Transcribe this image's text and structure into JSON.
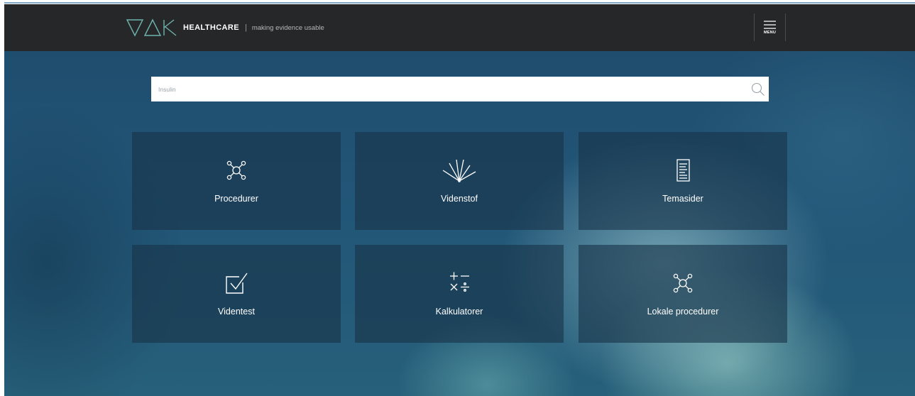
{
  "header": {
    "brand": "HEALTHCARE",
    "separator": "|",
    "tagline": "making evidence usable",
    "menu_label": "MENU",
    "logo_icon": "vak-logo-icon",
    "menu_icon": "hamburger-menu-icon"
  },
  "search": {
    "placeholder": "Insulin",
    "icon": "search-icon"
  },
  "tiles": [
    {
      "label": "Procedurer",
      "icon": "network-nodes-icon"
    },
    {
      "label": "Videnstof",
      "icon": "light-rays-icon"
    },
    {
      "label": "Temasider",
      "icon": "document-icon"
    },
    {
      "label": "Videntest",
      "icon": "checkbox-check-icon"
    },
    {
      "label": "Kalkulatorer",
      "icon": "math-operators-icon"
    },
    {
      "label": "Lokale procedurer",
      "icon": "network-nodes-icon"
    }
  ],
  "colors": {
    "header_bg": "#262728",
    "logo_accent": "#6fb3ad",
    "tile_bg": "rgba(24,52,72,0.62)",
    "text": "#ffffff"
  }
}
